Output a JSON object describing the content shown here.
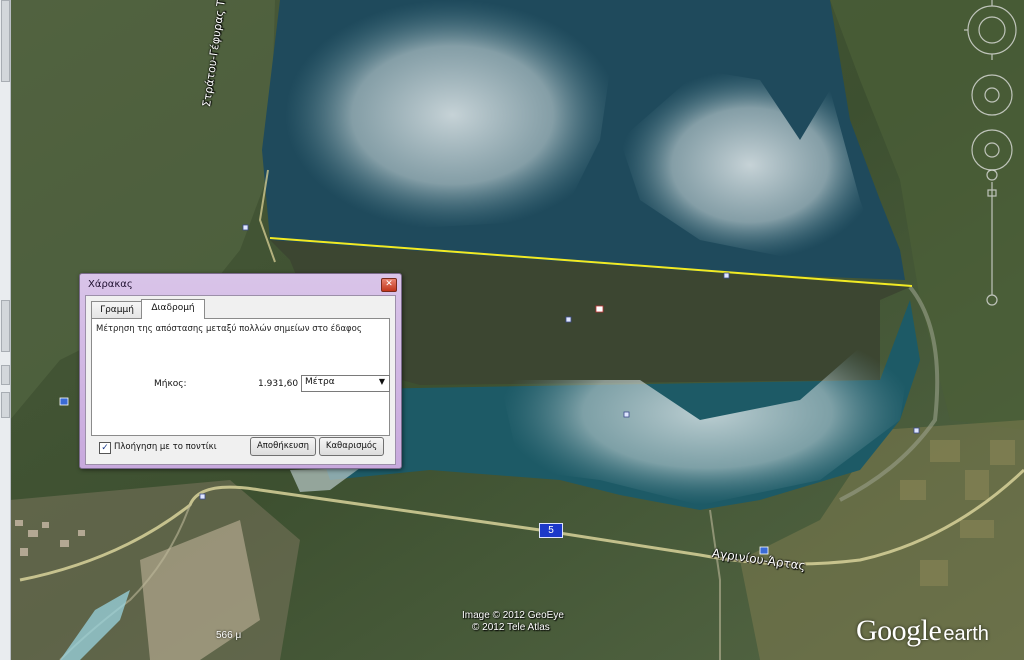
{
  "map": {
    "road_label_north": "Στράτου-Γέφυρας Ταταρνας",
    "road_label_south": "Αγρινίου-Άρτας",
    "route_number": "5",
    "credit_line1": "Image © 2012 GeoEye",
    "credit_line2": "© 2012 Tele Atlas",
    "elevation": "566 μ",
    "brand_main": "Google",
    "brand_sub": "earth",
    "measure_line_color": "#f2ea23"
  },
  "ruler_dialog": {
    "title": "Χάρακας",
    "close_icon": "close-icon",
    "tabs": [
      {
        "label": "Γραμμή",
        "active": false
      },
      {
        "label": "Διαδρομή",
        "active": true
      }
    ],
    "description": "Μέτρηση της απόστασης μεταξύ πολλών σημείων στο έδαφος",
    "length_label": "Μήκος:",
    "length_value": "1.931,60",
    "unit_selected": "Μέτρα",
    "mouse_nav_checked": true,
    "mouse_nav_label": "Πλοήγηση με το ποντίκι",
    "save_label": "Αποθήκευση",
    "clear_label": "Καθαρισμός"
  }
}
